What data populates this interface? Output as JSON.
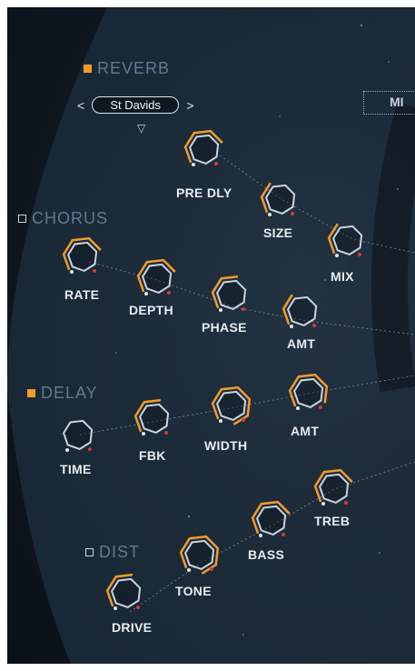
{
  "sections": {
    "reverb": {
      "name": "REVERB",
      "enabled": true,
      "preset": "St Davids",
      "prev": "<",
      "next": ">",
      "dropdown": "▽"
    },
    "chorus": {
      "name": "CHORUS",
      "enabled": false
    },
    "delay": {
      "name": "DELAY",
      "enabled": true
    },
    "dist": {
      "name": "DIST",
      "enabled": false
    }
  },
  "knobs": {
    "pre_dly": {
      "label": "PRE DLY",
      "value": 0.6
    },
    "size": {
      "label": "SIZE",
      "value": 0.35
    },
    "mix": {
      "label": "MIX",
      "value": 0.25
    },
    "rate": {
      "label": "RATE",
      "value": 0.55
    },
    "depth": {
      "label": "DEPTH",
      "value": 0.5
    },
    "phase": {
      "label": "PHASE",
      "value": 0.4
    },
    "chorus_amt": {
      "label": "AMT",
      "value": 0.3
    },
    "time": {
      "label": "TIME",
      "value": 0.0
    },
    "fbk": {
      "label": "FBK",
      "value": 0.45
    },
    "width": {
      "label": "WIDTH",
      "value": 0.9
    },
    "delay_amt": {
      "label": "AMT",
      "value": 0.65
    },
    "drive": {
      "label": "DRIVE",
      "value": 0.45
    },
    "tone": {
      "label": "TONE",
      "value": 0.85
    },
    "bass": {
      "label": "BASS",
      "value": 0.5
    },
    "treb": {
      "label": "TREB",
      "value": 0.55
    }
  },
  "mix_chip_label": "MI",
  "colors": {
    "accent": "#f39b2a",
    "knob_ring": "#c9d4de",
    "section_title": "#5f7a91",
    "indicator": "#d03a3a"
  }
}
